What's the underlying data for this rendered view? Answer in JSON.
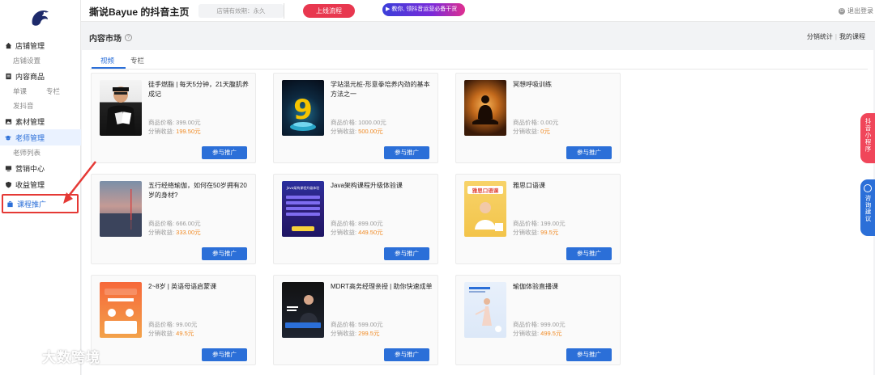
{
  "header": {
    "page_title": "撕说Bayue 的抖音主页",
    "expiry": "店铺有效期：永久",
    "process_button": "上线流程",
    "promo_pill": "▶ 教你, 领抖音运营必备干货",
    "logout": "退出登录"
  },
  "sidebar": {
    "groups": [
      {
        "label": "店铺管理",
        "subs": [
          "店铺设置"
        ]
      },
      {
        "label": "内容商品",
        "subs_row": [
          "单课",
          "专栏"
        ],
        "subs": [
          "发抖音"
        ]
      },
      {
        "label": "素材管理"
      },
      {
        "label": "老师管理",
        "subs": [
          "老师列表"
        ]
      },
      {
        "label": "营销中心"
      },
      {
        "label": "收益管理"
      },
      {
        "label": "课程推广"
      }
    ]
  },
  "section": {
    "title": "内容市场",
    "help": "?",
    "link_stats": "分销统计",
    "link_separator": "|",
    "link_courses": "我的课程"
  },
  "tabs": [
    "视频",
    "专栏"
  ],
  "cards": [
    {
      "title": "徒手燃脂 | 每天5分钟，21天腹肌养成记",
      "price": "商品价格: 399.00元",
      "earn_label": "分销收益: ",
      "earn": "199.50元",
      "button": "参与推广"
    },
    {
      "title": "学站混元桩-形意拳培养内劲的基本方法之一",
      "price": "商品价格: 1000.00元",
      "earn_label": "分销收益: ",
      "earn": "500.00元",
      "button": "参与推广"
    },
    {
      "title": "冥想呼吸训练",
      "price": "商品价格: 0.00元",
      "earn_label": "分销收益: ",
      "earn": "0元",
      "button": "参与推广"
    },
    {
      "title": "五行经络瑜伽，如何在50岁拥有20岁的身材?",
      "price": "商品价格: 666.00元",
      "earn_label": "分销收益: ",
      "earn": "333.00元",
      "button": "参与推广"
    },
    {
      "title": "Java架构课程升级体验课",
      "price": "商品价格: 899.00元",
      "earn_label": "分销收益: ",
      "earn": "449.50元",
      "button": "参与推广"
    },
    {
      "title": "雅思口语课",
      "price": "商品价格: 199.00元",
      "earn_label": "分销收益: ",
      "earn": "99.5元",
      "button": "参与推广"
    },
    {
      "title": "2~8岁 | 英语母语启蒙课",
      "price": "商品价格: 99.00元",
      "earn_label": "分销收益: ",
      "earn": "49.5元",
      "button": "参与推广"
    },
    {
      "title": "MDRT高务经理亲授 | 助你快速成单",
      "price": "商品价格: 599.00元",
      "earn_label": "分销收益: ",
      "earn": "299.5元",
      "button": "参与推广"
    },
    {
      "title": "瑜伽体验直播课",
      "price": "商品价格: 999.00元",
      "earn_label": "分销收益: ",
      "earn": "499.5元",
      "button": "参与推广"
    }
  ],
  "thumb_text": {
    "t2": "9",
    "t5": "Java架构课程升级体验",
    "t6": "雅思口语课"
  },
  "float": {
    "red": "抖音小程序",
    "blue": "咨询建议"
  },
  "watermark": "大数跨境",
  "colors": {
    "accent": "#2b6fd8",
    "price_orange": "#f08a24",
    "process_red": "#e8374f",
    "annotation_red": "#e53935"
  }
}
